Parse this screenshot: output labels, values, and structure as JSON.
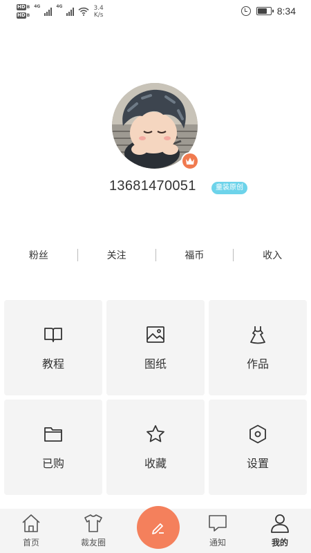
{
  "status_bar": {
    "hd_top": "HD",
    "hd_top_sub": "B",
    "hd_bottom": "HD",
    "hd_bottom_sub": "B",
    "network_type_1": "4G",
    "network_type_2": "4G",
    "net_speed_value": "3.4",
    "net_speed_unit": "K/s",
    "time": "8:34",
    "battery_level_percent": 75
  },
  "profile": {
    "phone": "13681470051",
    "badge": "童装原创"
  },
  "stats": [
    {
      "label": "粉丝"
    },
    {
      "label": "关注"
    },
    {
      "label": "福币"
    },
    {
      "label": "收入"
    }
  ],
  "grid": [
    {
      "label": "教程",
      "icon": "book-icon"
    },
    {
      "label": "图纸",
      "icon": "image-icon"
    },
    {
      "label": "作品",
      "icon": "dress-icon"
    },
    {
      "label": "已购",
      "icon": "folder-icon"
    },
    {
      "label": "收藏",
      "icon": "star-icon"
    },
    {
      "label": "设置",
      "icon": "settings-hexagon-icon"
    }
  ],
  "bottom_nav": [
    {
      "label": "首页",
      "icon": "home-icon"
    },
    {
      "label": "裁友圈",
      "icon": "shirt-icon"
    },
    {
      "label": "",
      "icon": "pencil-icon"
    },
    {
      "label": "通知",
      "icon": "message-icon"
    },
    {
      "label": "我的",
      "icon": "person-icon",
      "active": true
    }
  ],
  "colors": {
    "accent": "#f4805c",
    "badge_bg": "#6dd3ea",
    "tile_bg": "#f4f4f4"
  }
}
